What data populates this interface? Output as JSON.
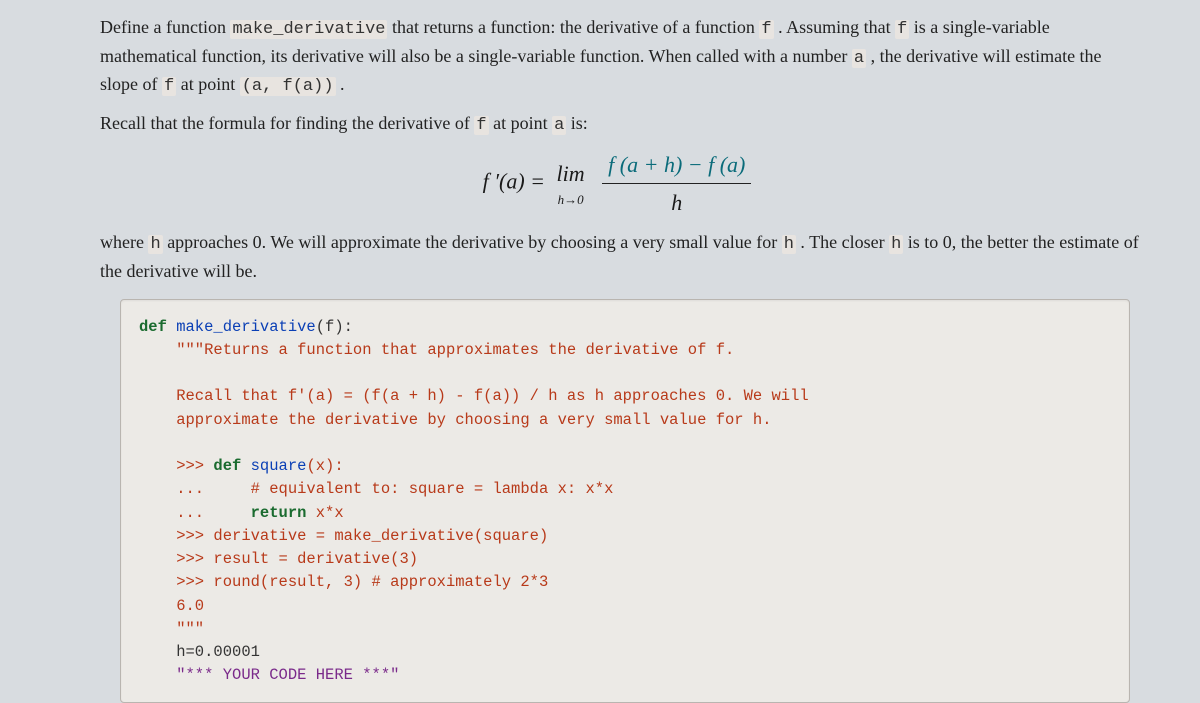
{
  "para1_a": "Define a function ",
  "code_make_derivative": "make_derivative",
  "para1_b": " that returns a function: the derivative of a function ",
  "code_f": "f",
  "para1_c": " . Assuming that ",
  "para1_d": " is a single-variable mathematical function, its derivative will also be a single-variable function. When called with a number ",
  "code_a": "a",
  "para1_e": " , the derivative will estimate the slope of ",
  "para1_f": " at point ",
  "code_pair": "(a, f(a))",
  "para1_g": " .",
  "para2_a": "Recall that the formula for finding the derivative of ",
  "para2_b": " at point ",
  "para2_c": " is:",
  "formula_lhs": "f ′(a) = ",
  "formula_lim": "lim",
  "formula_h0": "h→0",
  "formula_num": "f (a + h) − f (a)",
  "formula_den": "h",
  "para3_a": "where ",
  "code_h": "h",
  "para3_b": " approaches 0. We will approximate the derivative by choosing a very small value for ",
  "para3_c": " . The closer ",
  "para3_d": " is to 0, the better the estimate of the derivative will be.",
  "code": {
    "l1_def": "def",
    "l1_fn": " make_derivative",
    "l1_rest": "(f):",
    "l2": "    \"\"\"Returns a function that approximates the derivative of f.",
    "blank": "",
    "l3": "    Recall that f'(a) = (f(a + h) - f(a)) / h as h approaches 0. We will",
    "l4": "    approximate the derivative by choosing a very small value for h.",
    "l5_p": "    >>> ",
    "l5_def": "def",
    "l5_fn": " square",
    "l5_rest": "(x):",
    "l6": "    ...     # equivalent to: square = lambda x: x*x",
    "l7_a": "    ...     ",
    "l7_ret": "return",
    "l7_b": " x*x",
    "l8": "    >>> derivative = make_derivative(square)",
    "l9": "    >>> result = derivative(3)",
    "l10": "    >>> round(result, 3) # approximately 2*3",
    "l11": "    6.0",
    "l12": "    \"\"\"",
    "l13": "    h=0.00001",
    "l14": "    \"*** YOUR CODE HERE ***\""
  }
}
